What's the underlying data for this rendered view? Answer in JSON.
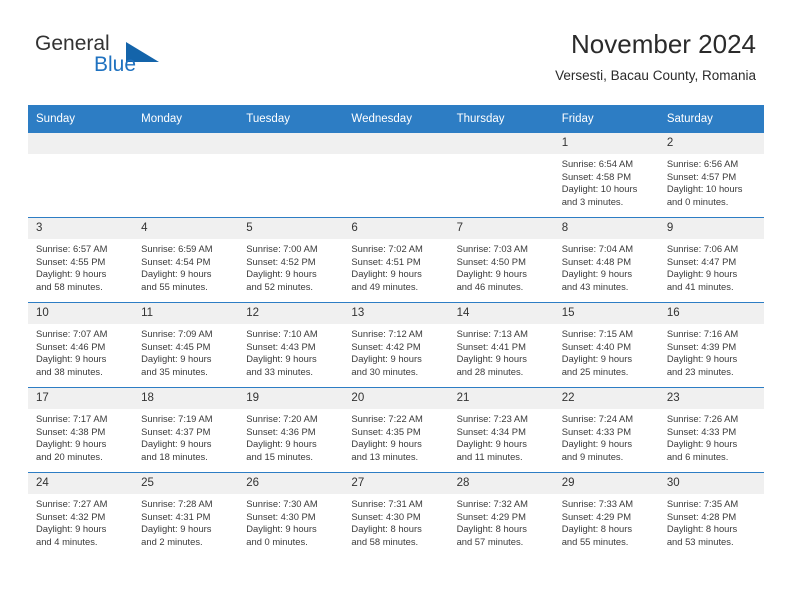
{
  "brand": {
    "name_part1": "General",
    "name_part2": "Blue",
    "triangle_color": "#1464aa",
    "blue_color": "#1f72c0"
  },
  "header": {
    "title": "November 2024",
    "subtitle": "Versesti, Bacau County, Romania"
  },
  "theme": {
    "header_bar_color": "#2d7dc4",
    "daynum_band_color": "#f0f0f0",
    "separator_color": "#2d7dc4"
  },
  "weekday_headers": [
    "Sunday",
    "Monday",
    "Tuesday",
    "Wednesday",
    "Thursday",
    "Friday",
    "Saturday"
  ],
  "weeks": [
    [
      {
        "day": "",
        "empty": true
      },
      {
        "day": "",
        "empty": true
      },
      {
        "day": "",
        "empty": true
      },
      {
        "day": "",
        "empty": true
      },
      {
        "day": "",
        "empty": true
      },
      {
        "day": "1",
        "sunrise": "Sunrise: 6:54 AM",
        "sunset": "Sunset: 4:58 PM",
        "daylight1": "Daylight: 10 hours",
        "daylight2": "and 3 minutes."
      },
      {
        "day": "2",
        "sunrise": "Sunrise: 6:56 AM",
        "sunset": "Sunset: 4:57 PM",
        "daylight1": "Daylight: 10 hours",
        "daylight2": "and 0 minutes."
      }
    ],
    [
      {
        "day": "3",
        "sunrise": "Sunrise: 6:57 AM",
        "sunset": "Sunset: 4:55 PM",
        "daylight1": "Daylight: 9 hours",
        "daylight2": "and 58 minutes."
      },
      {
        "day": "4",
        "sunrise": "Sunrise: 6:59 AM",
        "sunset": "Sunset: 4:54 PM",
        "daylight1": "Daylight: 9 hours",
        "daylight2": "and 55 minutes."
      },
      {
        "day": "5",
        "sunrise": "Sunrise: 7:00 AM",
        "sunset": "Sunset: 4:52 PM",
        "daylight1": "Daylight: 9 hours",
        "daylight2": "and 52 minutes."
      },
      {
        "day": "6",
        "sunrise": "Sunrise: 7:02 AM",
        "sunset": "Sunset: 4:51 PM",
        "daylight1": "Daylight: 9 hours",
        "daylight2": "and 49 minutes."
      },
      {
        "day": "7",
        "sunrise": "Sunrise: 7:03 AM",
        "sunset": "Sunset: 4:50 PM",
        "daylight1": "Daylight: 9 hours",
        "daylight2": "and 46 minutes."
      },
      {
        "day": "8",
        "sunrise": "Sunrise: 7:04 AM",
        "sunset": "Sunset: 4:48 PM",
        "daylight1": "Daylight: 9 hours",
        "daylight2": "and 43 minutes."
      },
      {
        "day": "9",
        "sunrise": "Sunrise: 7:06 AM",
        "sunset": "Sunset: 4:47 PM",
        "daylight1": "Daylight: 9 hours",
        "daylight2": "and 41 minutes."
      }
    ],
    [
      {
        "day": "10",
        "sunrise": "Sunrise: 7:07 AM",
        "sunset": "Sunset: 4:46 PM",
        "daylight1": "Daylight: 9 hours",
        "daylight2": "and 38 minutes."
      },
      {
        "day": "11",
        "sunrise": "Sunrise: 7:09 AM",
        "sunset": "Sunset: 4:45 PM",
        "daylight1": "Daylight: 9 hours",
        "daylight2": "and 35 minutes."
      },
      {
        "day": "12",
        "sunrise": "Sunrise: 7:10 AM",
        "sunset": "Sunset: 4:43 PM",
        "daylight1": "Daylight: 9 hours",
        "daylight2": "and 33 minutes."
      },
      {
        "day": "13",
        "sunrise": "Sunrise: 7:12 AM",
        "sunset": "Sunset: 4:42 PM",
        "daylight1": "Daylight: 9 hours",
        "daylight2": "and 30 minutes."
      },
      {
        "day": "14",
        "sunrise": "Sunrise: 7:13 AM",
        "sunset": "Sunset: 4:41 PM",
        "daylight1": "Daylight: 9 hours",
        "daylight2": "and 28 minutes."
      },
      {
        "day": "15",
        "sunrise": "Sunrise: 7:15 AM",
        "sunset": "Sunset: 4:40 PM",
        "daylight1": "Daylight: 9 hours",
        "daylight2": "and 25 minutes."
      },
      {
        "day": "16",
        "sunrise": "Sunrise: 7:16 AM",
        "sunset": "Sunset: 4:39 PM",
        "daylight1": "Daylight: 9 hours",
        "daylight2": "and 23 minutes."
      }
    ],
    [
      {
        "day": "17",
        "sunrise": "Sunrise: 7:17 AM",
        "sunset": "Sunset: 4:38 PM",
        "daylight1": "Daylight: 9 hours",
        "daylight2": "and 20 minutes."
      },
      {
        "day": "18",
        "sunrise": "Sunrise: 7:19 AM",
        "sunset": "Sunset: 4:37 PM",
        "daylight1": "Daylight: 9 hours",
        "daylight2": "and 18 minutes."
      },
      {
        "day": "19",
        "sunrise": "Sunrise: 7:20 AM",
        "sunset": "Sunset: 4:36 PM",
        "daylight1": "Daylight: 9 hours",
        "daylight2": "and 15 minutes."
      },
      {
        "day": "20",
        "sunrise": "Sunrise: 7:22 AM",
        "sunset": "Sunset: 4:35 PM",
        "daylight1": "Daylight: 9 hours",
        "daylight2": "and 13 minutes."
      },
      {
        "day": "21",
        "sunrise": "Sunrise: 7:23 AM",
        "sunset": "Sunset: 4:34 PM",
        "daylight1": "Daylight: 9 hours",
        "daylight2": "and 11 minutes."
      },
      {
        "day": "22",
        "sunrise": "Sunrise: 7:24 AM",
        "sunset": "Sunset: 4:33 PM",
        "daylight1": "Daylight: 9 hours",
        "daylight2": "and 9 minutes."
      },
      {
        "day": "23",
        "sunrise": "Sunrise: 7:26 AM",
        "sunset": "Sunset: 4:33 PM",
        "daylight1": "Daylight: 9 hours",
        "daylight2": "and 6 minutes."
      }
    ],
    [
      {
        "day": "24",
        "sunrise": "Sunrise: 7:27 AM",
        "sunset": "Sunset: 4:32 PM",
        "daylight1": "Daylight: 9 hours",
        "daylight2": "and 4 minutes."
      },
      {
        "day": "25",
        "sunrise": "Sunrise: 7:28 AM",
        "sunset": "Sunset: 4:31 PM",
        "daylight1": "Daylight: 9 hours",
        "daylight2": "and 2 minutes."
      },
      {
        "day": "26",
        "sunrise": "Sunrise: 7:30 AM",
        "sunset": "Sunset: 4:30 PM",
        "daylight1": "Daylight: 9 hours",
        "daylight2": "and 0 minutes."
      },
      {
        "day": "27",
        "sunrise": "Sunrise: 7:31 AM",
        "sunset": "Sunset: 4:30 PM",
        "daylight1": "Daylight: 8 hours",
        "daylight2": "and 58 minutes."
      },
      {
        "day": "28",
        "sunrise": "Sunrise: 7:32 AM",
        "sunset": "Sunset: 4:29 PM",
        "daylight1": "Daylight: 8 hours",
        "daylight2": "and 57 minutes."
      },
      {
        "day": "29",
        "sunrise": "Sunrise: 7:33 AM",
        "sunset": "Sunset: 4:29 PM",
        "daylight1": "Daylight: 8 hours",
        "daylight2": "and 55 minutes."
      },
      {
        "day": "30",
        "sunrise": "Sunrise: 7:35 AM",
        "sunset": "Sunset: 4:28 PM",
        "daylight1": "Daylight: 8 hours",
        "daylight2": "and 53 minutes."
      }
    ]
  ]
}
